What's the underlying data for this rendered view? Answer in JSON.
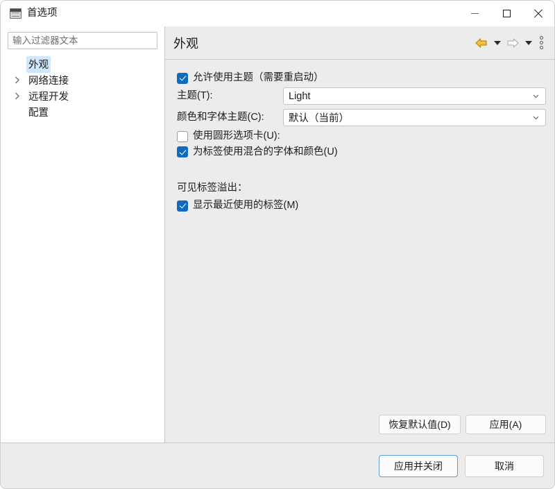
{
  "window": {
    "title": "首选项",
    "icon": "preferences-window-icon",
    "controls": {
      "minimize": "minimize-icon",
      "maximize": "maximize-icon",
      "close": "close-icon"
    }
  },
  "sidebar": {
    "filter": {
      "value": "",
      "placeholder": "输入过滤器文本"
    },
    "tree": [
      {
        "label": "外观",
        "expandable": false,
        "selected": true
      },
      {
        "label": "网络连接",
        "expandable": true,
        "selected": false
      },
      {
        "label": "远程开发",
        "expandable": true,
        "selected": false
      },
      {
        "label": "配置",
        "expandable": false,
        "selected": false
      }
    ]
  },
  "pane": {
    "title": "外观",
    "tools": {
      "back": "back-arrow-icon",
      "back_menu": "back-dropdown-caret-icon",
      "forward": "forward-arrow-icon",
      "forward_menu": "forward-dropdown-caret-icon",
      "menu": "view-menu-icon"
    },
    "options": [
      {
        "type": "checkbox",
        "label": "允许使用主题（需要重启动）",
        "checked": true,
        "name": "enable-theming-checkbox"
      },
      {
        "type": "combo",
        "label": "主题(T):",
        "value": "Light",
        "name": "theme-combo"
      },
      {
        "type": "combo",
        "label": "颜色和字体主题(C):",
        "value": "默认（当前）",
        "name": "color-font-theme-combo"
      },
      {
        "type": "checkbox",
        "label": "使用圆形选项卡(U):",
        "checked": false,
        "name": "round-tabs-checkbox"
      },
      {
        "type": "checkbox",
        "label": "为标签使用混合的字体和颜色(U)",
        "checked": true,
        "name": "mixed-fonts-colors-checkbox"
      }
    ],
    "section": {
      "label": "可见标签溢出：",
      "options": [
        {
          "type": "checkbox",
          "label": "显示最近使用的标签(M)",
          "checked": true,
          "name": "show-recent-tabs-checkbox"
        }
      ]
    },
    "buttons": {
      "restore_defaults": "恢复默认值(D)",
      "apply": "应用(A)"
    }
  },
  "footer": {
    "apply_and_close": "应用并关闭",
    "cancel": "取消"
  },
  "colors": {
    "accent_checkbox": "#0f6cbd",
    "selection": "#cde8ff",
    "back_arrow": "#e8a100",
    "focus_border": "#5a9cd8",
    "pane_background": "#ececec"
  }
}
